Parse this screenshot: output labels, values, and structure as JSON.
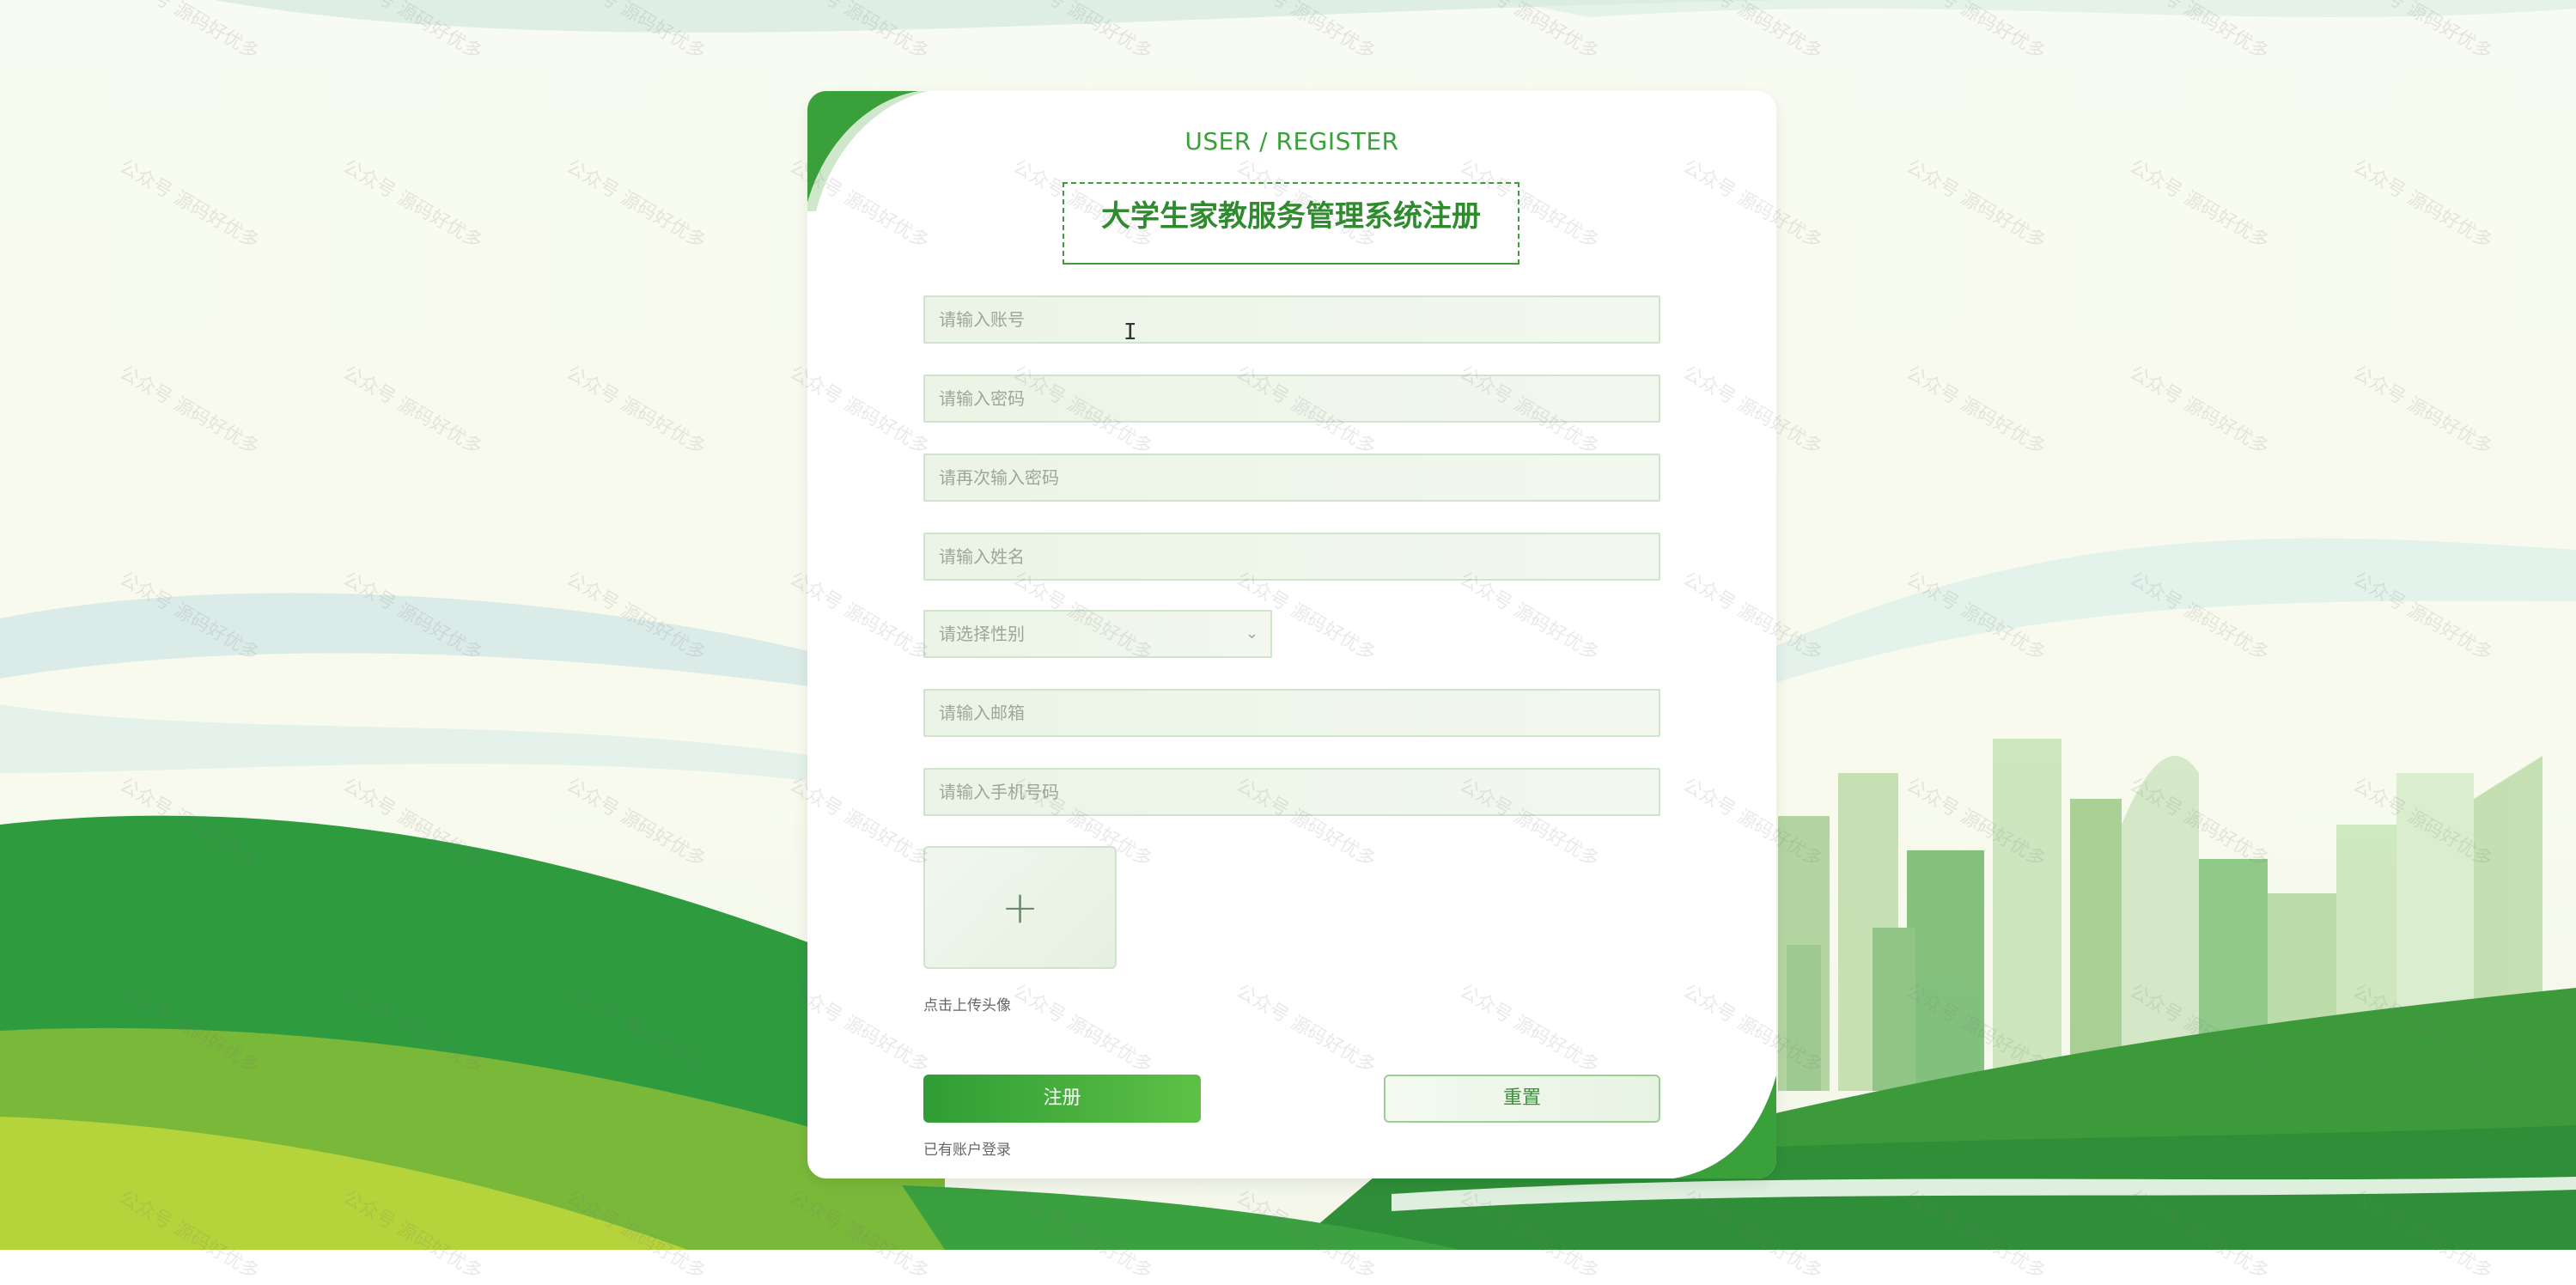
{
  "page": {
    "subtitle": "USER / REGISTER",
    "title": "大学生家教服务管理系统注册"
  },
  "form": {
    "account_placeholder": "请输入账号",
    "password_placeholder": "请输入密码",
    "confirm_password_placeholder": "请再次输入密码",
    "name_placeholder": "请输入姓名",
    "gender_placeholder": "请选择性别",
    "email_placeholder": "请输入邮箱",
    "phone_placeholder": "请输入手机号码",
    "upload_tip": "点击上传头像",
    "register_label": "注册",
    "reset_label": "重置",
    "login_link": "已有账户登录"
  },
  "watermark": "公众号 源码好优多",
  "icons": {
    "select": "chevron-down-icon",
    "upload": "plus-icon",
    "cursor": "text-cursor-icon"
  },
  "colors": {
    "accent": "#3aa039",
    "button": "#2f9d35",
    "field_border": "#cfe4cc"
  }
}
